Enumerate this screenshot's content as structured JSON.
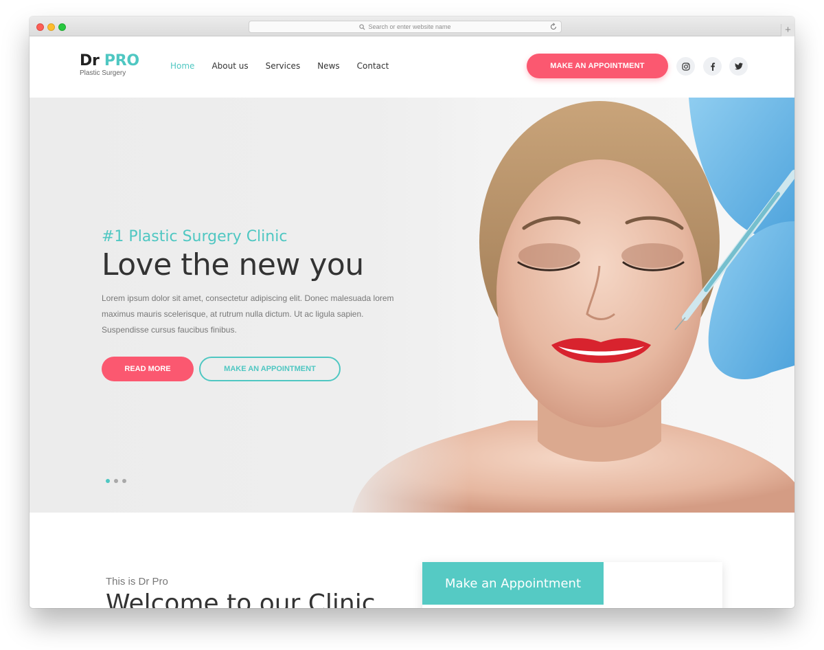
{
  "browser": {
    "url_placeholder": "Search or enter website name",
    "new_tab_label": "+"
  },
  "header": {
    "logo_main": "Dr",
    "logo_accent": "PRO",
    "logo_sub": "Plastic Surgery",
    "nav": [
      {
        "label": "Home",
        "active": true
      },
      {
        "label": "About us"
      },
      {
        "label": "Services"
      },
      {
        "label": "News"
      },
      {
        "label": "Contact"
      }
    ],
    "appointment_button": "MAKE AN APPOINTMENT",
    "social_icons": [
      "instagram-icon",
      "facebook-icon",
      "twitter-icon"
    ]
  },
  "hero": {
    "tagline": "#1 Plastic Surgery Clinic",
    "title": "Love the new you",
    "text": "Lorem ipsum dolor sit amet, consectetur adipiscing elit. Donec malesuada lorem maximus mauris scelerisque, at rutrum nulla dictum. Ut ac ligula sapien. Suspendisse cursus faucibus finibus.",
    "read_more": "READ MORE",
    "appointment_button": "MAKE AN APPOINTMENT",
    "slides": 3,
    "active_slide": 1
  },
  "welcome": {
    "subtitle": "This is Dr Pro",
    "title": "Welcome to our Clinic",
    "card_title": "Make an Appointment"
  },
  "colors": {
    "accent_teal": "#4fc7c2",
    "accent_pink": "#fb5870",
    "text_dark": "#333333"
  }
}
